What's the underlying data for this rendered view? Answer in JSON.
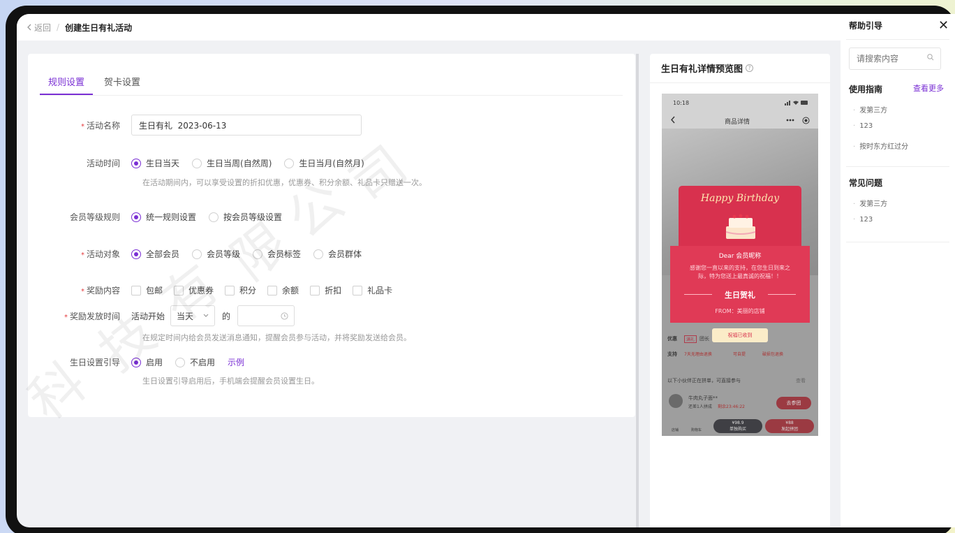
{
  "breadcrumb": {
    "back": "返回",
    "current": "创建生日有礼活动"
  },
  "tabs": [
    "规则设置",
    "贺卡设置"
  ],
  "form": {
    "activity_name": {
      "label": "活动名称",
      "value": "生日有礼  2023-06-13"
    },
    "activity_time": {
      "label": "活动时间",
      "options": [
        "生日当天",
        "生日当周(自然周)",
        "生日当月(自然月)"
      ],
      "hint": "在活动期间内，可以享受设置的折扣优惠，优惠券、积分余额、礼品卡只赠送一次。"
    },
    "member_level": {
      "label": "会员等级规则",
      "options": [
        "统一规则设置",
        "按会员等级设置"
      ]
    },
    "target": {
      "label": "活动对象",
      "options": [
        "全部会员",
        "会员等级",
        "会员标签",
        "会员群体"
      ]
    },
    "rewards": {
      "label": "奖励内容",
      "options": [
        "包邮",
        "优惠券",
        "积分",
        "余额",
        "折扣",
        "礼品卡"
      ]
    },
    "send_time": {
      "label": "奖励发放时间",
      "prefix": "活动开始",
      "select": "当天",
      "mid": "的",
      "hint": "在规定时间内给会员发送消息通知，提醒会员参与活动，并将奖励发送给会员。"
    },
    "guide": {
      "label": "生日设置引导",
      "options": [
        "启用",
        "不启用"
      ],
      "example": "示例",
      "hint": "生日设置引导启用后，手机端会提醒会员设置生日。"
    }
  },
  "preview": {
    "title": "生日有礼详情预览图",
    "phone": {
      "time": "10:18",
      "nav_title": "商品详情",
      "card_title": "Happy Birthday",
      "dear": "Dear 会员昵称",
      "msg1": "感谢您一直以来的支持，在您生日到来之",
      "msg2": "际，特为您送上最真诚的祝福！！",
      "gift": "生日贺礼",
      "from": "FROM：美丽的店铺",
      "button": "祝福已收到",
      "row_offer": "优惠",
      "row_offer_tag": "满礼",
      "row_offer_text": "团长",
      "row_support": "支持",
      "support_items": [
        "7天无理由退换",
        "可自提",
        "破损包退换"
      ],
      "group_text": "以下小伙伴正在拼单，可直接参与",
      "group_more": "查看",
      "user_name": "牛肉丸子面**",
      "user_sub": "还差1人拼成",
      "user_time": "剩余23:46:22",
      "join": "去参团",
      "bottom": {
        "shop": "店铺",
        "cart": "购物车",
        "buy_price": "¥98.9",
        "buy_label": "单独购买",
        "group_price": "¥88",
        "group_label": "发起拼团"
      }
    }
  },
  "help": {
    "title": "帮助引导",
    "search_placeholder": "请搜索内容",
    "guide_title": "使用指南",
    "more": "查看更多",
    "guide_items": [
      "发第三方",
      "123",
      "按时东方红过分"
    ],
    "faq_title": "常见问题",
    "faq_items": [
      "发第三方",
      "123"
    ]
  },
  "watermark": [
    "科",
    "技",
    "有",
    "限",
    "公",
    "司"
  ],
  "colors": {
    "accent": "#7a2fd4",
    "card_red": "#d8314e"
  }
}
